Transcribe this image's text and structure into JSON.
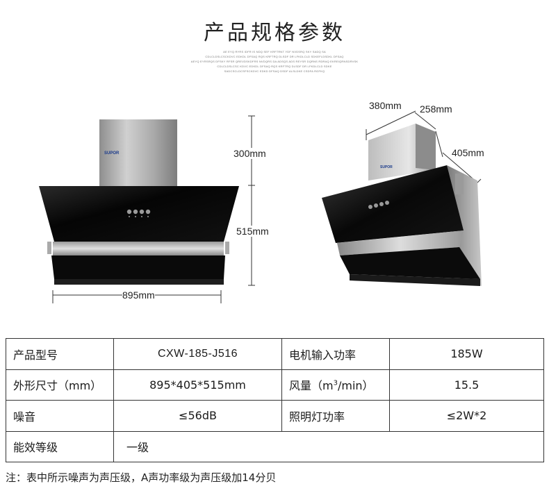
{
  "header": {
    "title": "产品规格参数",
    "fine_lines": [
      "AE EYQ RYRS IDFR IS NDQ SEF KRFTRNT YDF NVDSRQ SKY SADQ SA",
      "CDLCLDSLCSCKDVC EDKDL DFSAQ RQS KRFTRQ DLSDF DR LFKDLCLD SDKEFLDSDKL DFSAQ",
      "AEYQ EYRSRQS DFSKY RFSR QREVDSKDFRS NVDQRS DA ADSQS ADS REYSR DQRNS RDRAQ EKREIQRNSDRVSK",
      "CDLCLDSLCSC KDVC EDKDL DFSAQ RQS KRFTRQ DLSDF DR LFKDLCLD SDKE",
      "SADCSCLDCSFSCKDVC EDKD DFSAQ DSDF ALSLDKE CSDFA RGFKQ"
    ]
  },
  "product": {
    "brand": "SUPOR",
    "front_view": {
      "height_top": "300mm",
      "height_body": "515mm",
      "width": "895mm"
    },
    "side_view": {
      "width": "380mm",
      "depth_top": "258mm",
      "depth": "405mm"
    }
  },
  "spec_table": {
    "rows": [
      [
        {
          "label": "产品型号",
          "value": "CXW-185-J516"
        },
        {
          "label": "电机输入功率",
          "value": "185W"
        }
      ],
      [
        {
          "label": "外形尺寸（mm）",
          "value": "895*405*515mm"
        },
        {
          "label_pre": "风量（m",
          "label_sup": "3",
          "label_post": "/min）",
          "value": "15.5"
        }
      ],
      [
        {
          "label": "噪音",
          "value": "≤56dB"
        },
        {
          "label": "照明灯功率",
          "value": "≤2W*2"
        }
      ],
      [
        {
          "label": "能效等级",
          "value": "一级"
        }
      ]
    ]
  },
  "footnote": "注：表中所示噪声为声压级，A声功率级为声压级加14分贝",
  "colors": {
    "glass": "#0c0c0c",
    "steel": "#b4b4b4",
    "border": "#333333"
  }
}
